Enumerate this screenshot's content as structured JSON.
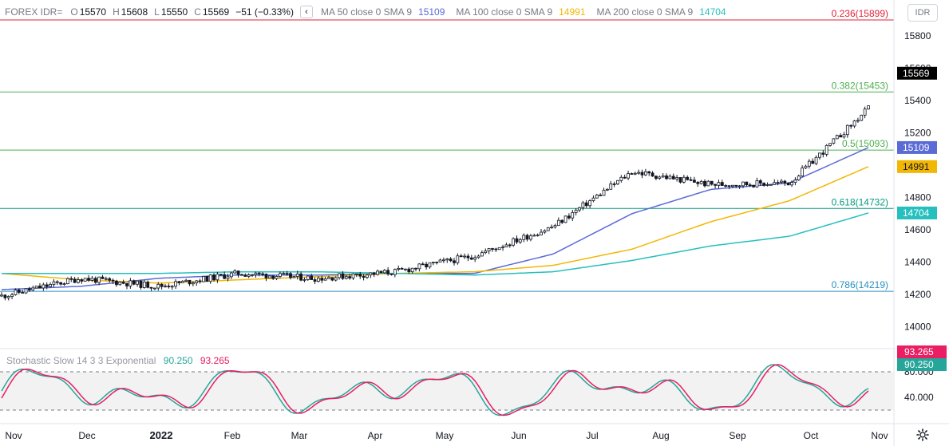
{
  "legend": {
    "symbol": "FOREX IDR=",
    "o_label": "O",
    "o_value": "15570",
    "h_label": "H",
    "h_value": "15608",
    "l_label": "L",
    "l_value": "15550",
    "c_label": "C",
    "c_value": "15569",
    "change": "−51 (−0.33%)",
    "collapse_icon": "chevron-left-icon",
    "ma50": {
      "label": "MA 50 close 0 SMA 9",
      "value": "15109",
      "color": "#5b6bd6"
    },
    "ma100": {
      "label": "MA 100 close 0 SMA 9",
      "value": "14991",
      "color": "#f2b705"
    },
    "ma200": {
      "label": "MA 200 close 0 SMA 9",
      "value": "14704",
      "color": "#26bfbf"
    }
  },
  "currency_button": "IDR",
  "price_axis": [
    "15800",
    "15600",
    "15400",
    "15200",
    "15000",
    "14800",
    "14600",
    "14400",
    "14200",
    "14000"
  ],
  "price_badges": {
    "last": {
      "value": "15569",
      "bg": "#000000"
    },
    "ma50": {
      "value": "15109",
      "bg": "#5b6bd6"
    },
    "ma100": {
      "value": "14991",
      "bg": "#f2b705"
    },
    "ma200": {
      "value": "14704",
      "bg": "#26bfbf"
    }
  },
  "fib_levels": [
    {
      "label": "0.236(15899)",
      "price": 15899,
      "color": "#e0213a"
    },
    {
      "label": "0.382(15453)",
      "price": 15453,
      "color": "#4caf50"
    },
    {
      "label": "0.5(15093)",
      "price": 15093,
      "color": "#4caf50"
    },
    {
      "label": "0.618(14732)",
      "price": 14732,
      "color": "#089981"
    },
    {
      "label": "0.786(14219)",
      "price": 14219,
      "color": "#2a8fbf"
    }
  ],
  "oscillator": {
    "label": "Stochastic Slow 14 3 3 Exponential",
    "k_value": "90.250",
    "d_value": "93.265",
    "k_color": "#26a69a",
    "d_color": "#e91e63",
    "axis": [
      "80.000",
      "40.000"
    ],
    "upper_band": 80,
    "lower_band": 20
  },
  "time_axis": [
    "Nov",
    "Dec",
    "2022",
    "Feb",
    "Mar",
    "Apr",
    "May",
    "Jun",
    "Jul",
    "Aug",
    "Sep",
    "Oct",
    "Nov"
  ],
  "settings_icon": "gear-icon",
  "chart_data": {
    "type": "line",
    "x": [
      "Nov",
      "Dec",
      "2022",
      "Feb",
      "Mar",
      "Apr",
      "May",
      "Jun",
      "Jul",
      "Aug",
      "Sep",
      "Oct"
    ],
    "series": [
      {
        "values": [
          14190,
          14300,
          14250,
          14330,
          14300,
          14340,
          14440,
          14620,
          14960,
          14880,
          14890,
          15350
        ]
      },
      {
        "name": "MA 50 close 0 SMA 9",
        "values": [
          14230,
          14250,
          14300,
          14320,
          14320,
          14330,
          14330,
          14450,
          14700,
          14850,
          14890,
          15109
        ]
      },
      {
        "name": "MA 100 close 0 SMA 9",
        "values": [
          14330,
          14290,
          14270,
          14290,
          14310,
          14330,
          14340,
          14380,
          14480,
          14650,
          14780,
          14991
        ]
      },
      {
        "name": "MA 200 close 0 SMA 9",
        "values": [
          14330,
          14330,
          14330,
          14340,
          14340,
          14330,
          14320,
          14340,
          14410,
          14500,
          14560,
          14704
        ]
      }
    ],
    "ylim": [
      13950,
      15950
    ],
    "grid": false
  }
}
